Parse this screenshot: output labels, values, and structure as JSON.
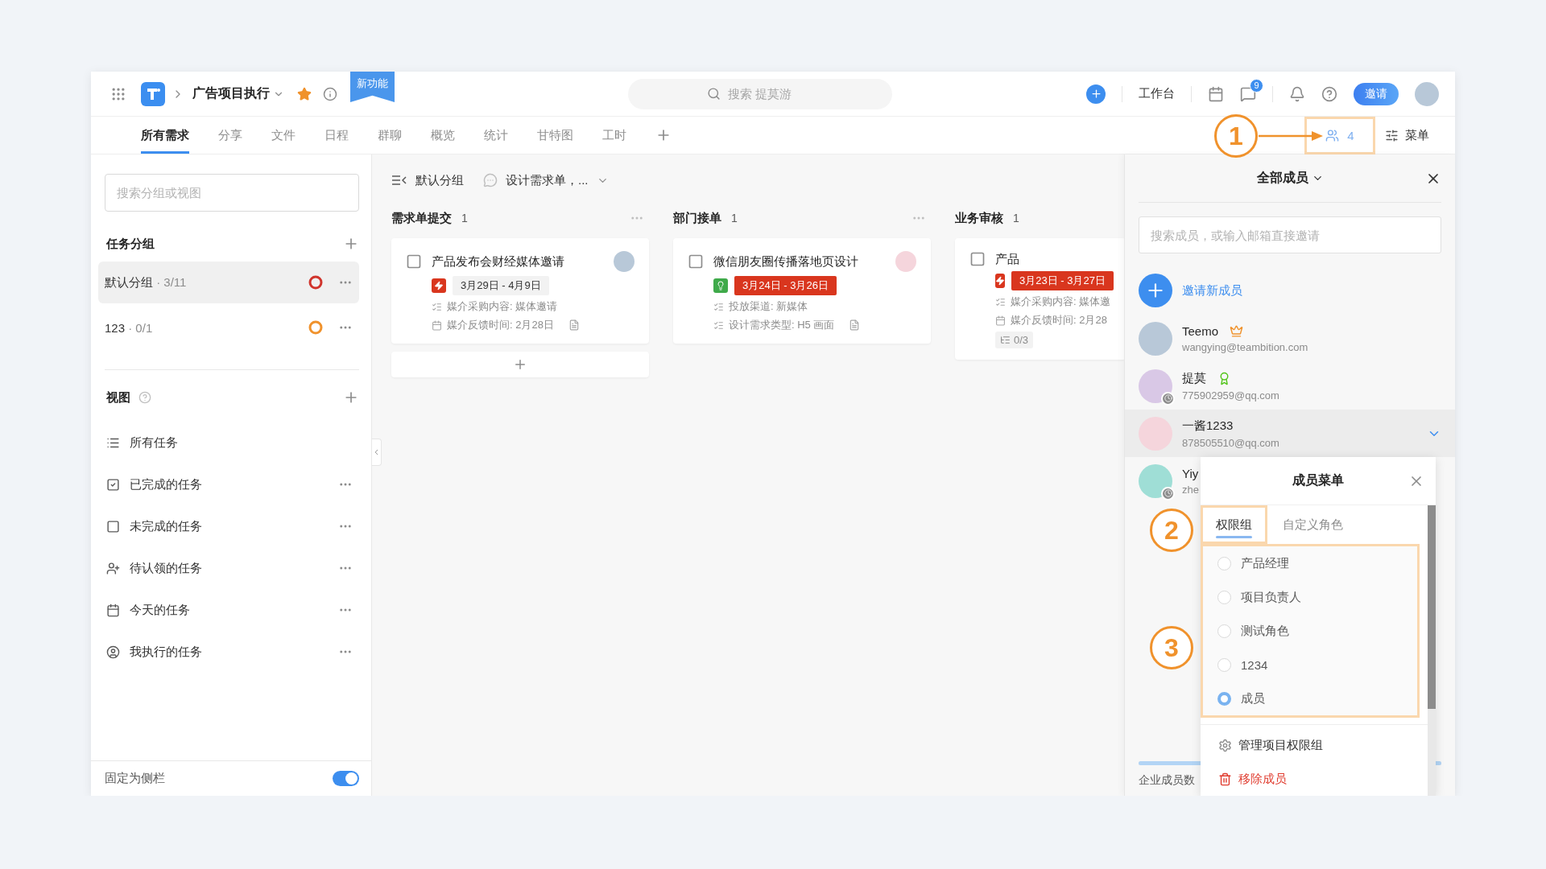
{
  "topbar": {
    "project": "广告项目执行",
    "new_badge": "新功能",
    "search_placeholder": "搜索 提莫游",
    "workbench": "工作台",
    "message_count": "9",
    "invite": "邀请"
  },
  "tabs": [
    {
      "label": "所有需求",
      "selected": true
    },
    {
      "label": "分享",
      "selected": false
    },
    {
      "label": "文件",
      "selected": false
    },
    {
      "label": "日程",
      "selected": false
    },
    {
      "label": "群聊",
      "selected": false
    },
    {
      "label": "概览",
      "selected": false
    },
    {
      "label": "统计",
      "selected": false
    },
    {
      "label": "甘特图",
      "selected": false
    },
    {
      "label": "工时",
      "selected": false
    }
  ],
  "members_button": {
    "count": "4",
    "highlighted": true,
    "annotation": "1"
  },
  "menu_button": "菜单",
  "sidebar": {
    "search_placeholder": "搜索分组或视图",
    "groups_title": "任务分组",
    "groups": [
      {
        "label": "默认分组",
        "count": "· 3/11",
        "selected": true,
        "color": "#d0342c"
      },
      {
        "label": "123",
        "count": "· 0/1",
        "selected": false,
        "color": "#f0922c"
      }
    ],
    "views_title": "视图",
    "views": [
      {
        "kind": "list",
        "label": "所有任务",
        "more": false
      },
      {
        "kind": "done",
        "label": "已完成的任务",
        "more": true
      },
      {
        "kind": "todo",
        "label": "未完成的任务",
        "more": true
      },
      {
        "kind": "claim",
        "label": "待认领的任务",
        "more": true
      },
      {
        "kind": "today",
        "label": "今天的任务",
        "more": true
      },
      {
        "kind": "mine",
        "label": "我执行的任务",
        "more": true
      }
    ],
    "pin_label": "固定为侧栏",
    "pin_on": true
  },
  "board": {
    "group": "默认分组",
    "filter": "设计需求单，...",
    "columns": [
      {
        "title": "需求单提交",
        "count": "1",
        "more": true,
        "add": true,
        "cards": [
          {
            "kind": "urgent",
            "title": "产品发布会财经媒体邀请",
            "date": "3月29日 - 4月9日",
            "overdue": false,
            "fields": [
              {
                "kind": "list",
                "text": "媒介采购内容: 媒体邀请"
              },
              {
                "kind": "date",
                "text": "媒介反馈时间: 2月28日"
              }
            ],
            "note": true
          }
        ]
      },
      {
        "title": "部门接单",
        "count": "1",
        "more": true,
        "add": false,
        "cards": [
          {
            "kind": "idea",
            "title": "微信朋友圈传播落地页设计",
            "date": "3月24日 - 3月26日",
            "overdue": true,
            "fields": [
              {
                "kind": "list",
                "text": "投放渠道: 新媒体"
              },
              {
                "kind": "list",
                "text": "设计需求类型: H5 画面"
              }
            ],
            "note": true
          }
        ]
      },
      {
        "title": "业务审核",
        "count": "1",
        "more": false,
        "add": false,
        "cards": [
          {
            "kind": "urgent",
            "title": "产品",
            "date": "3月23日 - 3月27日",
            "overdue": true,
            "fields": [
              {
                "kind": "list",
                "text": "媒介采购内容: 媒体邀"
              },
              {
                "kind": "date",
                "text": "媒介反馈时间: 2月28"
              }
            ],
            "note": false,
            "subtasks": "0/3"
          }
        ]
      }
    ]
  },
  "panel": {
    "title": "全部成员",
    "search_placeholder": "搜索成员，或输入邮箱直接邀请",
    "invite_label": "邀请新成员",
    "members": [
      {
        "kind": "owner",
        "name": "Teemo",
        "email": "wangying@teambition.com",
        "away": false,
        "selected": false
      },
      {
        "kind": "admin",
        "name": "提莫",
        "email": "775902959@qq.com",
        "away": true,
        "selected": false
      },
      {
        "kind": "member",
        "name": "一酱1233",
        "email": "878505510@qq.com",
        "away": false,
        "selected": true
      },
      {
        "kind": "member",
        "name": "Yiy",
        "email": "zhe",
        "away": true,
        "selected": false
      }
    ],
    "footer": {
      "label": "企业成员数",
      "level": 1
    }
  },
  "popup": {
    "title": "成员菜单",
    "tabs": [
      {
        "label": "权限组",
        "selected": true,
        "highlighted": true
      },
      {
        "label": "自定义角色",
        "selected": false,
        "highlighted": false
      }
    ],
    "tabs_annotation": "2",
    "roles_annotation": "3",
    "roles_highlighted": true,
    "roles": [
      {
        "label": "产品经理",
        "selected": false
      },
      {
        "label": "项目负责人",
        "selected": false
      },
      {
        "label": "测试角色",
        "selected": false
      },
      {
        "label": "1234",
        "selected": false
      },
      {
        "label": "成员",
        "selected": true
      }
    ],
    "actions": [
      {
        "kind": "settings",
        "label": "管理项目权限组"
      },
      {
        "kind": "danger",
        "label": "移除成员"
      }
    ]
  }
}
